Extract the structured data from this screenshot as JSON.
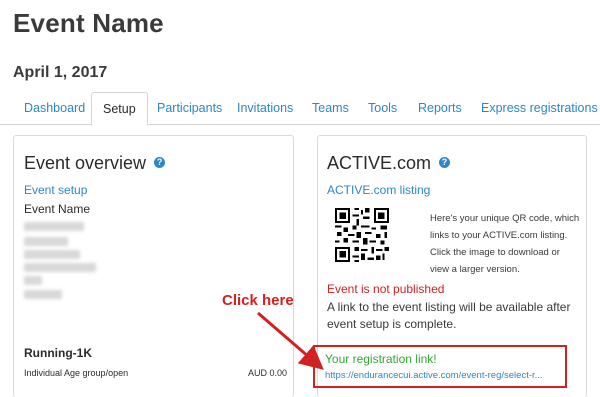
{
  "event": {
    "name": "Event Name",
    "date": "April 1, 2017"
  },
  "tabs": [
    {
      "label": "Dashboard"
    },
    {
      "label": "Setup",
      "active": true
    },
    {
      "label": "Participants"
    },
    {
      "label": "Invitations"
    },
    {
      "label": "Teams"
    },
    {
      "label": "Tools"
    },
    {
      "label": "Reports"
    },
    {
      "label": "Express registrations"
    }
  ],
  "overview": {
    "title": "Event overview",
    "help_icon": "question-circle-icon",
    "setup_link": "Event setup",
    "event_name_label": "Event Name",
    "race_name": "Running-1K",
    "race_category": "Individual Age group/open",
    "race_price": "AUD 0.00"
  },
  "active": {
    "title": "ACTIVE.com",
    "help_icon": "question-circle-icon",
    "listing_link": "ACTIVE.com listing",
    "qr_description": "Here's your unique QR code, which links to your ACTIVE.com listing. Click the image to download or view a larger version.",
    "status": "Event is not published",
    "note": "A link to the event listing will be available after event setup is complete.",
    "reg_label": "Your registration link!",
    "reg_url": "https://endurancecui.active.com/event-reg/select-r..."
  },
  "annotation": {
    "text": "Click here"
  },
  "colors": {
    "link": "#2c87c5",
    "error": "#d32020",
    "success": "#36a536",
    "annotation": "#d32020"
  }
}
